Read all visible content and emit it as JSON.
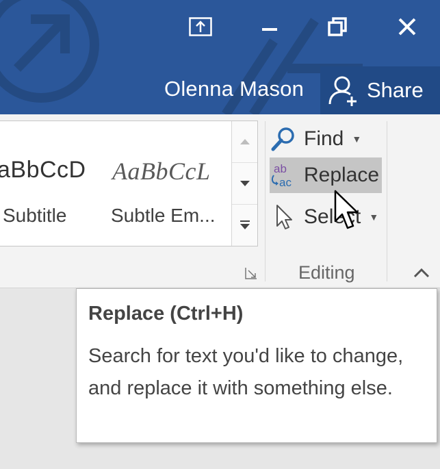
{
  "titlebar": {
    "user_name": "Olenna Mason",
    "share_label": "Share",
    "controls": [
      "ribbon-display-options",
      "minimize",
      "restore-down",
      "close"
    ],
    "accent_color": "#2b579a"
  },
  "styles_gallery": {
    "items": [
      {
        "preview": "aBbCcD",
        "label": "Subtitle"
      },
      {
        "preview": "AaBbCcL",
        "label": "Subtle Em..."
      }
    ]
  },
  "editing_group": {
    "find_label": "Find",
    "replace_label": "Replace",
    "select_label": "Select",
    "group_label": "Editing",
    "icons": [
      "find-magnifier-icon",
      "replace-ab-ac-icon",
      "select-pointer-icon"
    ]
  },
  "tooltip": {
    "title": "Replace (Ctrl+H)",
    "description": "Search for text you'd like to change, and replace it with something else."
  }
}
